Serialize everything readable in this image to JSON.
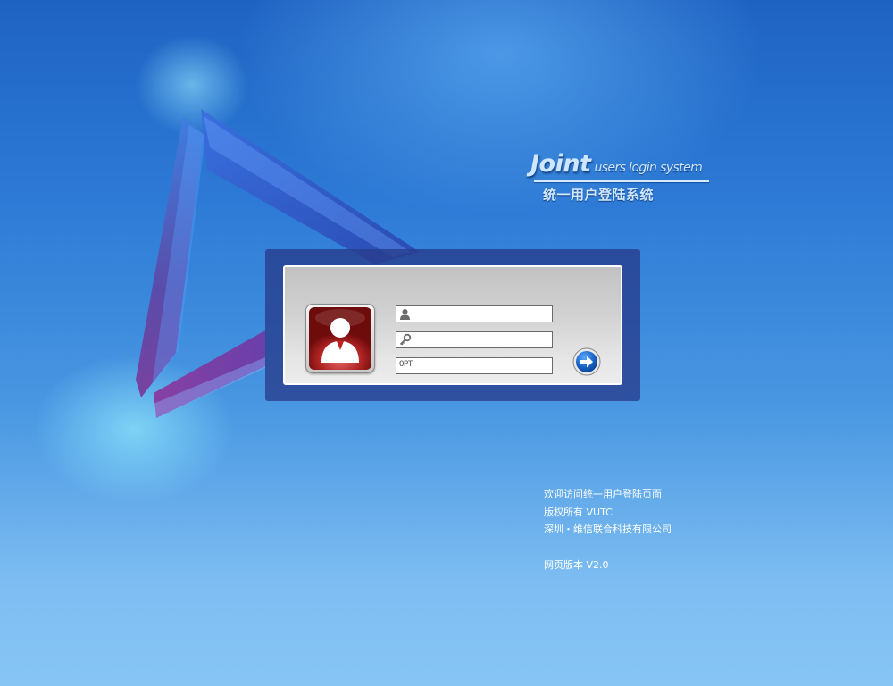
{
  "brand": {
    "title": "Joint",
    "subtitle": "users login system",
    "chinese_title": "统一用户登陆系统"
  },
  "login": {
    "avatar_icon": "user-avatar-icon",
    "username": {
      "value": "",
      "icon": "user-icon"
    },
    "password": {
      "value": "",
      "icon": "key-icon"
    },
    "otp": {
      "label": "OPT",
      "value": ""
    },
    "submit_icon": "arrow-right-icon"
  },
  "info": {
    "welcome": "欢迎访问统一用户登陆页面",
    "copyright": "版权所有 VUTC",
    "company": "深圳・维信联合科技有限公司",
    "version": "网页版本 V2.0"
  },
  "colors": {
    "background_top": "#1f63c2",
    "background_bottom": "#86c5f4",
    "panel_outer": "#283c8c",
    "panel_inner": "#d1d1d1",
    "avatar_red": "#b02424",
    "submit_blue": "#1560c0"
  }
}
